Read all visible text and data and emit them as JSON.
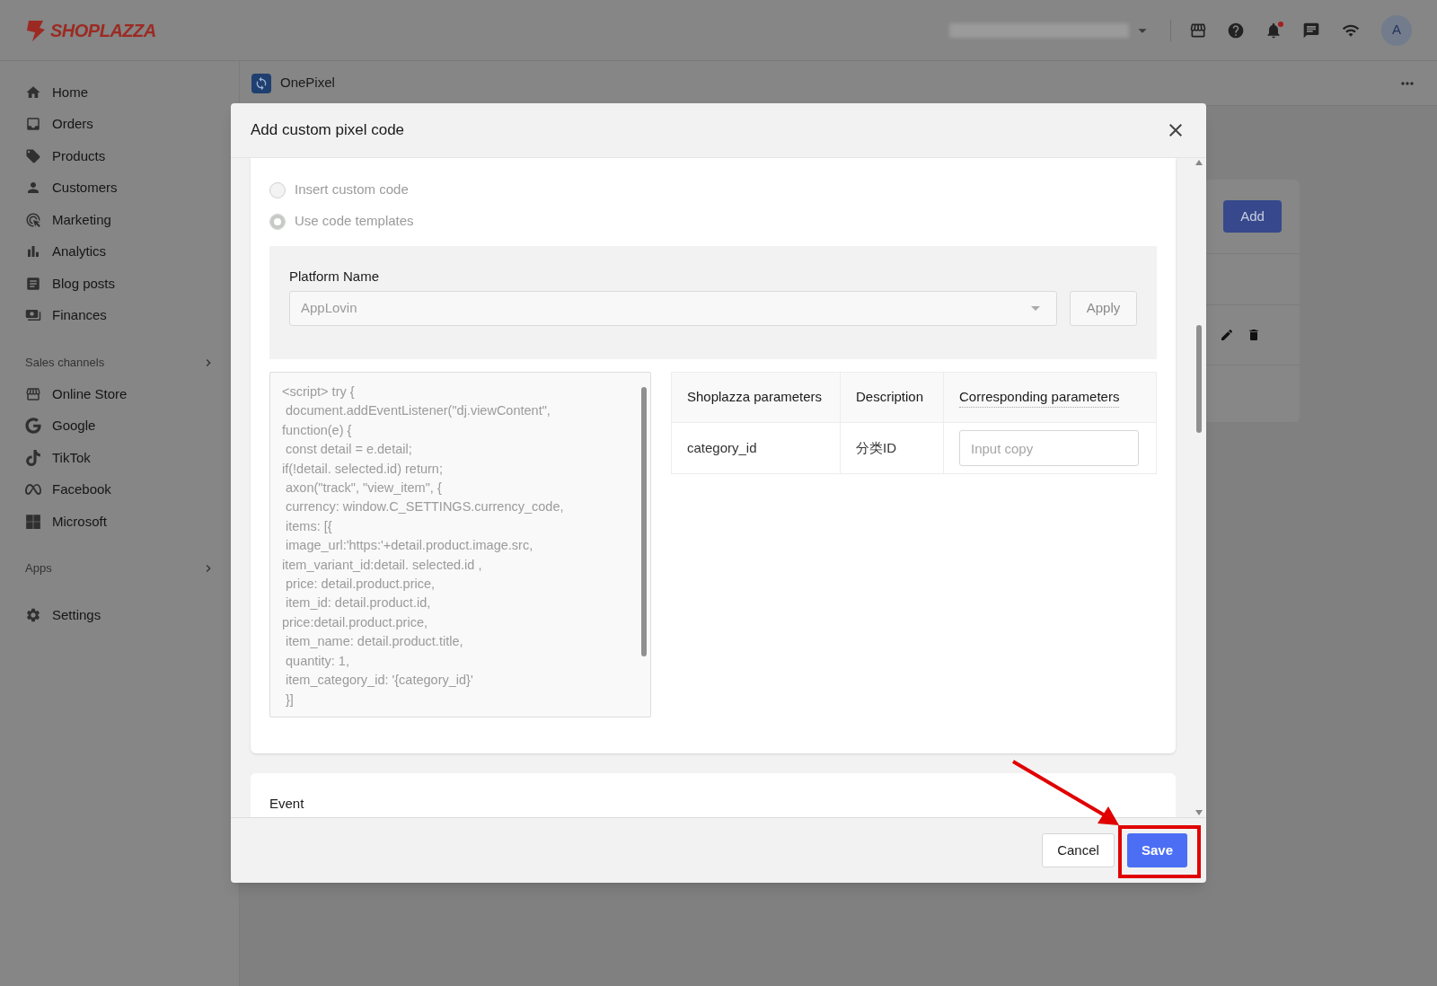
{
  "topbar": {
    "brand": "SHOPLAZZA",
    "avatar": "A",
    "notification_dot": true
  },
  "sidebar": {
    "main": [
      "Home",
      "Orders",
      "Products",
      "Customers",
      "Marketing",
      "Analytics",
      "Blog posts",
      "Finances"
    ],
    "sales_channels": {
      "title": "Sales channels",
      "items": [
        "Online Store",
        "Google",
        "TikTok",
        "Facebook",
        "Microsoft"
      ]
    },
    "apps": {
      "title": "Apps"
    },
    "settings": "Settings"
  },
  "page": {
    "title": "OnePixel",
    "add_button": "Add"
  },
  "modal": {
    "title": "Add custom pixel code",
    "radios": [
      {
        "label": "Insert custom code",
        "selected": false
      },
      {
        "label": "Use code templates",
        "selected": true
      }
    ],
    "radios_disabled": true,
    "platform": {
      "label": "Platform Name",
      "value": "AppLovin",
      "apply": "Apply"
    },
    "code": "<script> try {\n document.addEventListener(\"dj.viewContent\",\nfunction(e) {\n const detail = e.detail;\nif(!detail. selected.id) return;\n axon(\"track\", \"view_item\", {\n currency: window.C_SETTINGS.currency_code,\n items: [{\n image_url:'https:'+detail.product.image.src,\nitem_variant_id:detail. selected.id ,\n price: detail.product.price,\n item_id: detail.product.id,\nprice:detail.product.price,\n item_name: detail.product.title,\n quantity: 1,\n item_category_id: '{category_id}'\n }]",
    "table": {
      "columns": [
        "Shoplazza parameters",
        "Description",
        "Corresponding parameters"
      ],
      "rows": [
        {
          "parameter": "category_id",
          "description": "分类ID",
          "placeholder": "Input copy"
        }
      ]
    },
    "event_title": "Event",
    "buttons": {
      "cancel": "Cancel",
      "save": "Save"
    },
    "save_highlighted": true
  }
}
